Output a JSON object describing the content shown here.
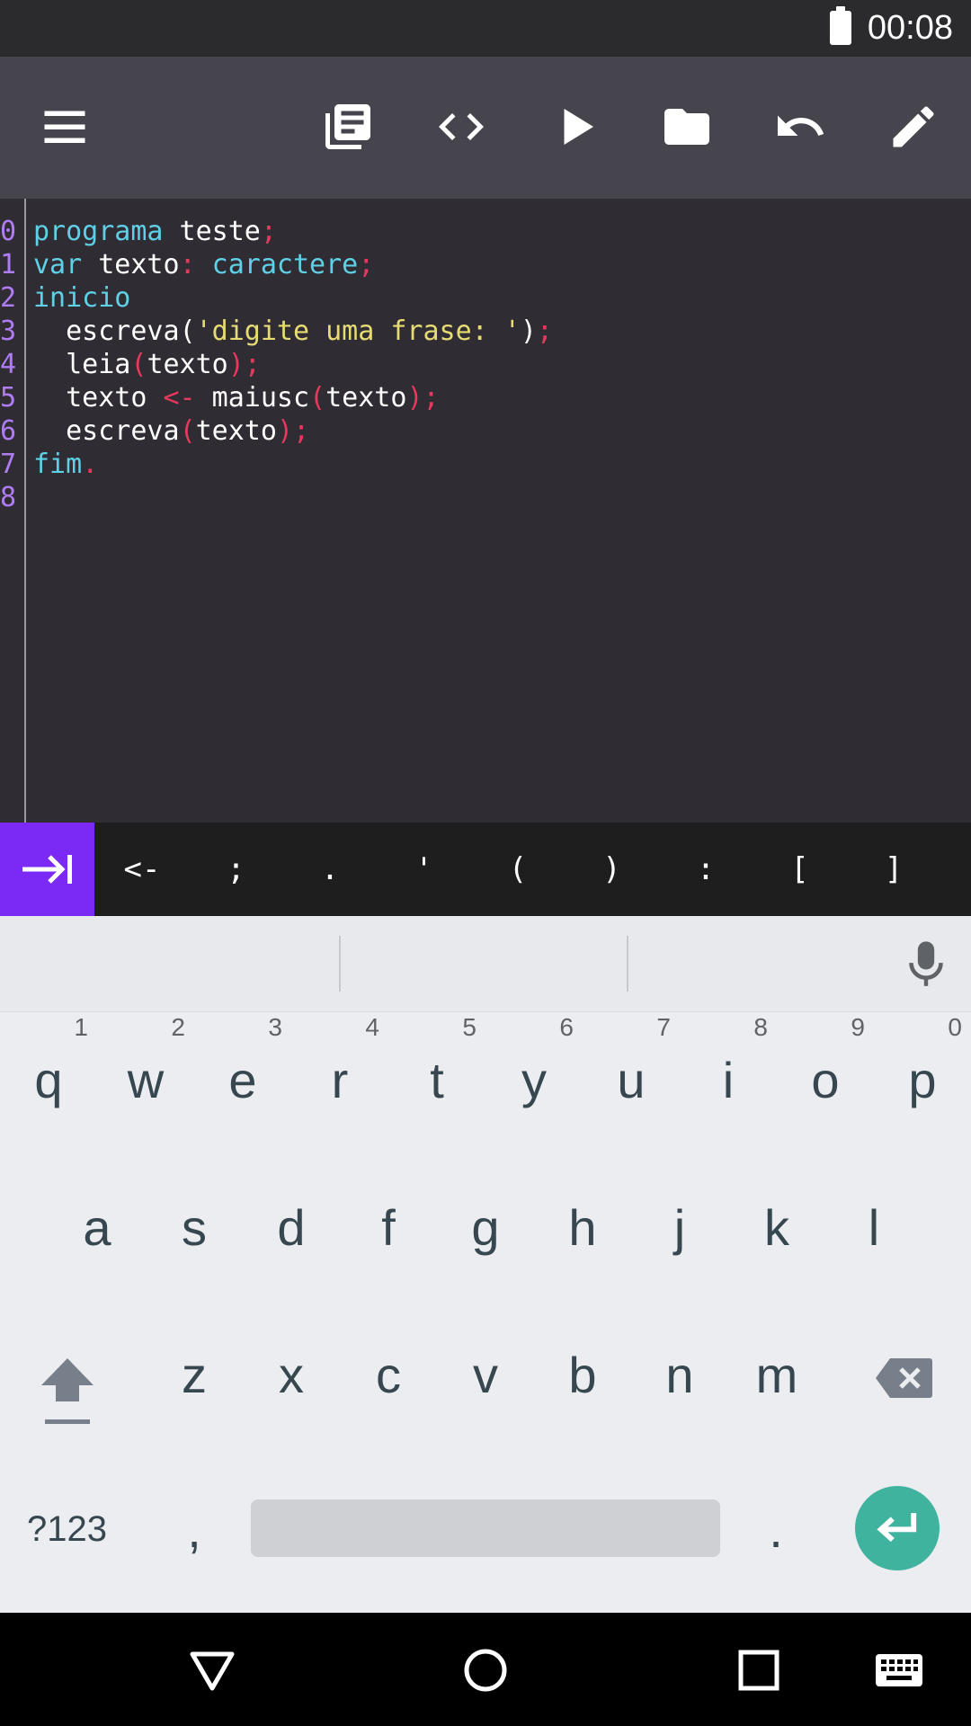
{
  "status": {
    "time": "00:08"
  },
  "toolbar": {
    "icons": [
      "menu-icon",
      "library-icon",
      "code-icon",
      "play-icon",
      "folder-icon",
      "undo-icon",
      "edit-icon"
    ]
  },
  "editor": {
    "line_numbers": [
      "0",
      "1",
      "2",
      "3",
      "4",
      "5",
      "6",
      "7",
      "8"
    ],
    "lines": [
      [
        [
          "kw",
          "programa"
        ],
        [
          "tx",
          " teste"
        ],
        [
          "pu",
          ";"
        ]
      ],
      [
        [
          "kw",
          "var"
        ],
        [
          "tx",
          " texto"
        ],
        [
          "pu",
          ":"
        ],
        [
          "kw",
          " caractere"
        ],
        [
          "pu",
          ";"
        ]
      ],
      [
        [
          "kw",
          "inicio"
        ]
      ],
      [
        [
          "tx",
          "  escreva("
        ],
        [
          "st",
          "'digite uma frase: '"
        ],
        [
          "tx",
          ")"
        ],
        [
          "pu",
          ";"
        ]
      ],
      [
        [
          "tx",
          "  leia"
        ],
        [
          "pu",
          "("
        ],
        [
          "tx",
          "texto"
        ],
        [
          "pu",
          ");"
        ]
      ],
      [
        [
          "tx",
          "  texto "
        ],
        [
          "pu",
          "<-"
        ],
        [
          "tx",
          " maiusc"
        ],
        [
          "pu",
          "("
        ],
        [
          "tx",
          "texto"
        ],
        [
          "pu",
          ");"
        ]
      ],
      [
        [
          "tx",
          "  escreva"
        ],
        [
          "pu",
          "("
        ],
        [
          "tx",
          "texto"
        ],
        [
          "pu",
          ");"
        ]
      ],
      [
        [
          "kw",
          "fim"
        ],
        [
          "pu",
          "."
        ]
      ],
      []
    ]
  },
  "symbols": [
    "<-",
    ";",
    ".",
    "'",
    "(",
    ")",
    ":",
    "[",
    "]"
  ],
  "keyboard": {
    "row1": [
      "q",
      "w",
      "e",
      "r",
      "t",
      "y",
      "u",
      "i",
      "o",
      "p"
    ],
    "row1_hints": [
      "1",
      "2",
      "3",
      "4",
      "5",
      "6",
      "7",
      "8",
      "9",
      "0"
    ],
    "row2": [
      "a",
      "s",
      "d",
      "f",
      "g",
      "h",
      "j",
      "k",
      "l"
    ],
    "row3": [
      "z",
      "x",
      "c",
      "v",
      "b",
      "n",
      "m"
    ],
    "sym_key": "?123",
    "comma": ",",
    "period": "."
  },
  "colors": {
    "accent": "#7b2af5",
    "enter": "#40b39f",
    "keyword": "#5fd0e6",
    "punct": "#e8385d",
    "string": "#e7dc74"
  }
}
